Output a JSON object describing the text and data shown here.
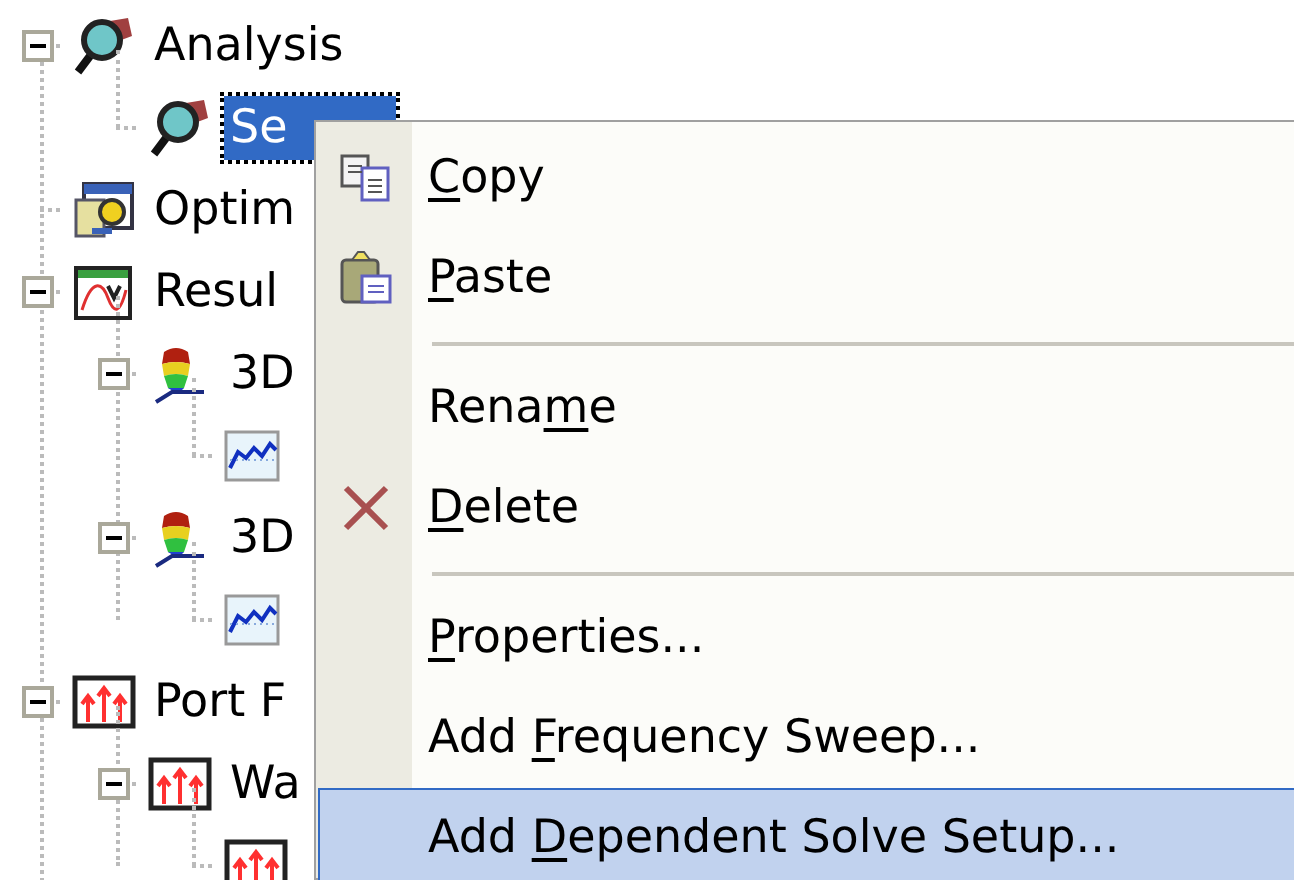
{
  "tree": [
    {
      "label": "Analysis",
      "kind": "analysis",
      "expanded": true,
      "selected": false,
      "children": [
        {
          "label": "Se",
          "kind": "analysis",
          "selected": true
        }
      ]
    },
    {
      "label": "Optim",
      "kind": "optimetrics",
      "selected": false
    },
    {
      "label": "Resul",
      "kind": "results",
      "expanded": true,
      "selected": false,
      "children": [
        {
          "label": "3D",
          "kind": "plot3d",
          "expanded": true,
          "selected": false,
          "children": [
            {
              "kind": "report"
            }
          ]
        },
        {
          "label": "3D",
          "kind": "plot3d",
          "expanded": true,
          "selected": false,
          "children": [
            {
              "kind": "report"
            }
          ]
        }
      ]
    },
    {
      "label": "Port F",
      "kind": "port",
      "expanded": true,
      "selected": false,
      "children": [
        {
          "label": "Wa",
          "kind": "port",
          "expanded": true,
          "selected": false,
          "children": [
            {
              "kind": "port"
            }
          ]
        }
      ]
    }
  ],
  "context_menu": [
    {
      "kind": "copy",
      "label": {
        "key": "C",
        "post": "opy"
      },
      "selected": false
    },
    {
      "kind": "paste",
      "label": {
        "key": "P",
        "post": "aste"
      },
      "selected": false
    },
    {
      "kind": "separator"
    },
    {
      "kind": "item",
      "label": {
        "pre": "Rena",
        "key": "m",
        "post": "e"
      },
      "selected": false
    },
    {
      "kind": "delete",
      "label": {
        "key": "D",
        "post": "elete"
      },
      "selected": false
    },
    {
      "kind": "separator"
    },
    {
      "kind": "item",
      "label": {
        "key": "P",
        "post": "roperties..."
      },
      "selected": false
    },
    {
      "kind": "item",
      "label": {
        "pre": "Add ",
        "key": "F",
        "post": "requency Sweep..."
      },
      "selected": false
    },
    {
      "kind": "item",
      "label": {
        "pre": "Add ",
        "key": "D",
        "post": "ependent Solve Setup..."
      },
      "selected": true
    }
  ]
}
